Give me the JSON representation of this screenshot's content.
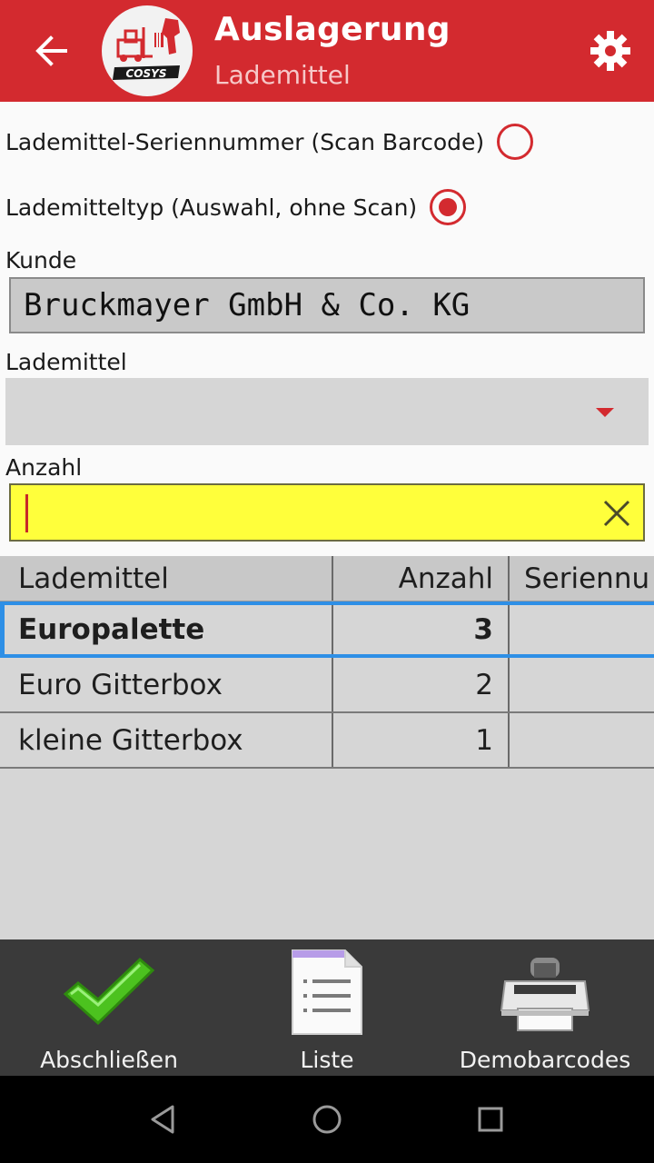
{
  "app_bar": {
    "title": "Auslagerung",
    "subtitle": "Lademittel",
    "logo_text": "COSYS",
    "accent": "#d32a2f"
  },
  "mode": {
    "option_serial": "Lademittel-Seriennummer (Scan Barcode)",
    "option_type": "Lademitteltyp (Auswahl, ohne Scan)",
    "selected": "type"
  },
  "kunde": {
    "label": "Kunde",
    "value": "Bruckmayer GmbH & Co. KG"
  },
  "lademittel": {
    "label": "Lademittel",
    "value": ""
  },
  "anzahl": {
    "label": "Anzahl",
    "value": "",
    "highlight": "#ffff3b"
  },
  "table": {
    "headers": [
      "Lademittel",
      "Anzahl",
      "Seriennu"
    ],
    "rows": [
      {
        "lademittel": "Europalette",
        "anzahl": "3",
        "serie": "",
        "selected": true
      },
      {
        "lademittel": "Euro Gitterbox",
        "anzahl": "2",
        "serie": "",
        "selected": false
      },
      {
        "lademittel": "kleine Gitterbox",
        "anzahl": "1",
        "serie": "",
        "selected": false
      }
    ]
  },
  "toolbar": {
    "finish_label": "Abschließen",
    "list_label": "Liste",
    "demo_label": "Demobarcodes"
  },
  "icons": {
    "back": "arrow-left-icon",
    "settings": "gear-icon",
    "clear": "close-icon",
    "finish": "checkmark-icon",
    "list": "document-list-icon",
    "demo": "printer-icon"
  }
}
